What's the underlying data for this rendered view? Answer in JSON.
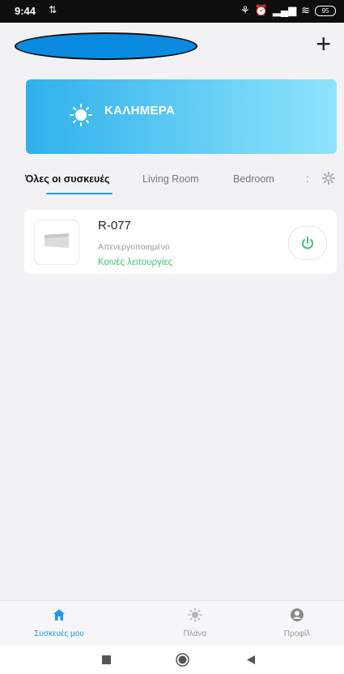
{
  "status_bar": {
    "time": "9:44",
    "sim_icon": "4G",
    "battery": "95"
  },
  "header": {
    "add_label": "+"
  },
  "greeting": {
    "title": "ΚΑΛΗΜΕΡΑ"
  },
  "tabs": [
    {
      "label": "Όλες οι συσκευές"
    },
    {
      "label": "Living Room"
    },
    {
      "label": "Bedroom"
    }
  ],
  "tab_more": ":",
  "device": {
    "name": "R-077",
    "status": "Απενεργοποιημένο",
    "functions_link": "Κοινές λειτουργίες"
  },
  "bottom_nav": [
    {
      "label": "Συσκευές μου",
      "icon": "home-icon",
      "active": true
    },
    {
      "label": "Πλάνα",
      "icon": "sun-icon",
      "active": false
    },
    {
      "label": "Προφίλ",
      "icon": "profile-icon",
      "active": false
    }
  ],
  "colors": {
    "accent": "#2196f3",
    "green": "#3ec37a",
    "banner_start": "#2fb0ea",
    "banner_end": "#8ee4fb"
  }
}
